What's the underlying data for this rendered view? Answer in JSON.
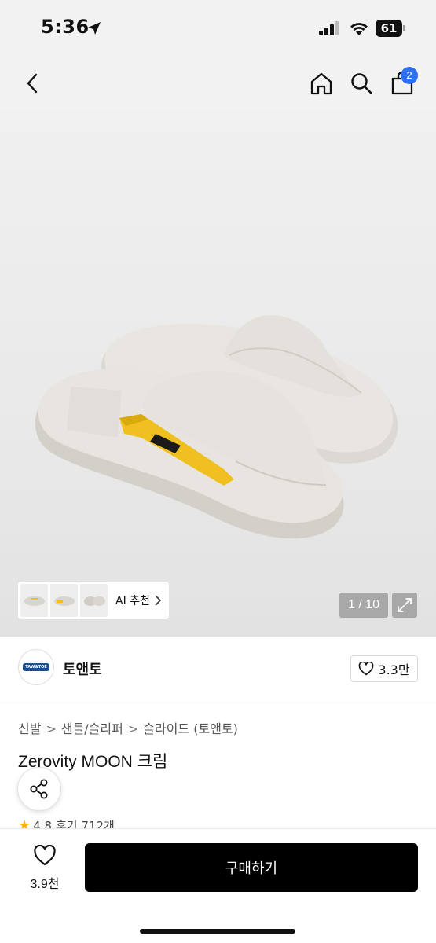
{
  "status_bar": {
    "time": "5:36",
    "battery": "61"
  },
  "nav": {
    "cart_count": "2"
  },
  "gallery": {
    "ai_label": "AI 추천",
    "counter": "1 / 10",
    "thumbnails": [
      "thumb-1",
      "thumb-2",
      "thumb-3"
    ]
  },
  "brand": {
    "name": "토앤토",
    "logo_text": "TAW&TOE",
    "likes": "3.3만"
  },
  "product": {
    "breadcrumb": [
      "신발",
      "샌들/슬리퍼",
      "슬라이드 (토앤토)"
    ],
    "title": "Zerovity MOON 크림",
    "rating": "4.8",
    "review_label": "후기 712개"
  },
  "bottom": {
    "wish_count": "3.9천",
    "buy_label": "구매하기"
  },
  "colors": {
    "accent_blue": "#2f6ff2",
    "strap_yellow": "#f0c020",
    "sandal_cream": "#e4e1dc",
    "buy_bg": "#000000"
  }
}
